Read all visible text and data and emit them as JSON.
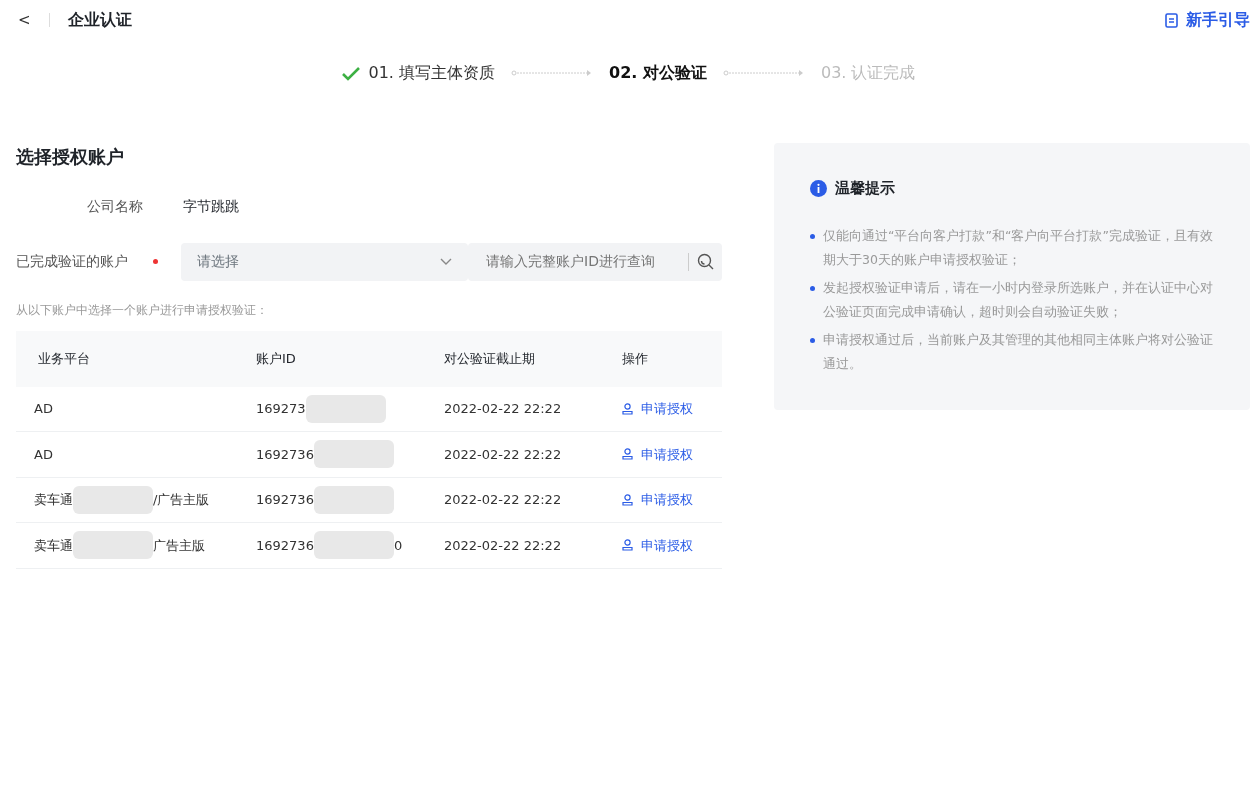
{
  "header": {
    "back": "<",
    "title": "企业认证",
    "guide_link": "新手引导"
  },
  "steps": [
    {
      "label": "01. 填写主体资质",
      "completed": true,
      "selected": false
    },
    {
      "label": "02. 对公验证",
      "completed": false,
      "selected": true
    },
    {
      "label": "03. 认证完成",
      "completed": false,
      "selected": false
    }
  ],
  "section_title": "选择授权账户",
  "form": {
    "company_label": "公司名称",
    "company_value": "字节跳跳",
    "account_label": "已完成验证的账户",
    "required": true,
    "select_placeholder": "请选择",
    "search_placeholder": "请输入完整账户ID进行查询"
  },
  "hint": "从以下账户中选择一个账户进行申请授权验证：",
  "table": {
    "columns": [
      "业务平台",
      "账户ID",
      "对公验证截止期",
      "操作"
    ],
    "rows": [
      {
        "platform": {
          "before": "AD",
          "redacted": false
        },
        "account_id": {
          "before": "169273",
          "redacted": true
        },
        "deadline": "2022-02-22 22:22",
        "action": "申请授权"
      },
      {
        "platform": {
          "before": "AD",
          "redacted": false
        },
        "account_id": {
          "before": "1692736",
          "redacted": true
        },
        "deadline": "2022-02-22 22:22",
        "action": "申请授权"
      },
      {
        "platform": {
          "before": "卖车通",
          "redacted": true,
          "after": "/广告主版"
        },
        "account_id": {
          "before": "1692736",
          "redacted": true
        },
        "deadline": "2022-02-22 22:22",
        "action": "申请授权"
      },
      {
        "platform": {
          "before": "卖车通",
          "redacted": true,
          "after": "广告主版"
        },
        "account_id": {
          "before": "1692736",
          "redacted": true,
          "after": "0"
        },
        "deadline": "2022-02-22 22:22",
        "action": "申请授权"
      }
    ]
  },
  "tips": {
    "title": "温馨提示",
    "items": [
      "仅能向通过“平台向客户打款”和“客户向平台打款”完成验证，且有效期大于30天的账户申请授权验证；",
      "发起授权验证申请后，请在一小时内登录所选账户，并在认证中心对公验证页面完成申请确认，超时则会自动验证失败；",
      "申请授权通过后，当前账户及其管理的其他相同主体账户将对公验证通过。"
    ]
  }
}
